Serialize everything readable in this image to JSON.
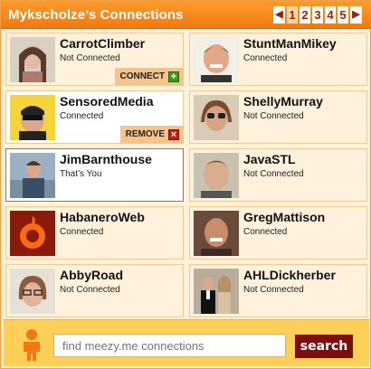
{
  "widget": {
    "title": "Mykscholze’s Connections",
    "pager": {
      "prev_icon": "triangle-left-icon",
      "next_icon": "triangle-right-icon",
      "pages": [
        "1",
        "2",
        "3",
        "4",
        "5"
      ],
      "current": "1"
    }
  },
  "connections": [
    {
      "name": "CarrotClimber",
      "status": "Not Connected",
      "action": "CONNECT",
      "action_icon": "plus-icon"
    },
    {
      "name": "StuntManMikey",
      "status": "Connected"
    },
    {
      "name": "SensoredMedia",
      "status": "Connected",
      "action": "REMOVE",
      "action_icon": "x-icon"
    },
    {
      "name": "ShellyMurray",
      "status": "Not Connected"
    },
    {
      "name": "JimBarnthouse",
      "status": "That’s You"
    },
    {
      "name": "JavaSTL",
      "status": "Not Connected"
    },
    {
      "name": "HabaneroWeb",
      "status": "Connected"
    },
    {
      "name": "GregMattison",
      "status": "Connected"
    },
    {
      "name": "AbbyRoad",
      "status": "Not Connected"
    },
    {
      "name": "AHLDickherber",
      "status": "Not Connected"
    }
  ],
  "search": {
    "placeholder": "find meezy.me connections",
    "button_label": "search"
  },
  "colors": {
    "header_orange": "#f07a10",
    "search_button": "#7b0f0f",
    "footer_yellow": "#ffcf58",
    "connect_green": "#3a9a1a",
    "remove_red": "#c02010"
  }
}
